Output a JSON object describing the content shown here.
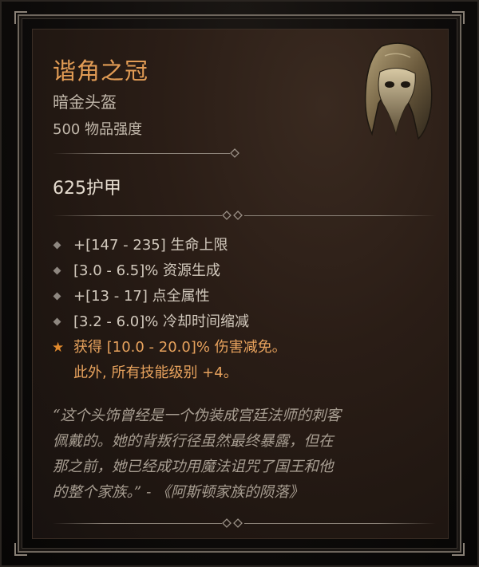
{
  "item": {
    "name": "谐角之冠",
    "type": "暗金头盔",
    "item_power": "500 物品强度",
    "armor": "625护甲",
    "icon": "helm-icon",
    "colors": {
      "unique_orange": "#e29c55",
      "stat_text": "#d2c9bd",
      "flavor_text": "#a89e92"
    }
  },
  "stats": [
    {
      "text": "+[147 - 235] 生命上限",
      "bullet": "diamond-bullet"
    },
    {
      "text": "[3.0 - 6.5]% 资源生成",
      "bullet": "diamond-bullet"
    },
    {
      "text": "+[13 - 17] 点全属性",
      "bullet": "diamond-bullet"
    },
    {
      "text": "[3.2 - 6.0]% 冷却时间缩减",
      "bullet": "diamond-bullet"
    }
  ],
  "unique_power": {
    "line1": "获得 [10.0 - 20.0]% 伤害减免。",
    "line2": "此外, 所有技能级别 +4。",
    "bullet": "star-bullet",
    "star_glyph": "★"
  },
  "flavor": {
    "line1": "“这个头饰曾经是一个伪装成宫廷法师的刺客",
    "line2": "佩戴的。她的背叛行径虽然最终暴露，但在",
    "line3": "那之前，她已经成功用魔法诅咒了国王和他",
    "line4": "的整个家族。” - 《阿斯顿家族的陨落》"
  }
}
